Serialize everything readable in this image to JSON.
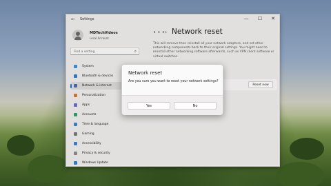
{
  "window": {
    "app_title": "Settings",
    "back_icon": "back-arrow-icon",
    "controls": {
      "minimize": "—",
      "maximize": "☐",
      "close": "✕"
    }
  },
  "user": {
    "name": "MDTechVideos",
    "account_type": "Local Account"
  },
  "search": {
    "placeholder": "Find a setting",
    "icon": "search-icon"
  },
  "sidebar": {
    "items": [
      {
        "label": "System",
        "icon": "monitor-icon",
        "color": "#3b8fd6",
        "active": false
      },
      {
        "label": "Bluetooth & devices",
        "icon": "bluetooth-icon",
        "color": "#2a7fd0",
        "active": false
      },
      {
        "label": "Network & internet",
        "icon": "wifi-icon",
        "color": "#4a6aa8",
        "active": true
      },
      {
        "label": "Personalization",
        "icon": "brush-icon",
        "color": "#d07a2a",
        "active": false
      },
      {
        "label": "Apps",
        "icon": "apps-icon",
        "color": "#6b6bd0",
        "active": false
      },
      {
        "label": "Accounts",
        "icon": "person-icon",
        "color": "#2e9e6c",
        "active": false
      },
      {
        "label": "Time & language",
        "icon": "globe-clock-icon",
        "color": "#3a86c8",
        "active": false
      },
      {
        "label": "Gaming",
        "icon": "gamepad-icon",
        "color": "#777777",
        "active": false
      },
      {
        "label": "Accessibility",
        "icon": "accessibility-icon",
        "color": "#3a7fd0",
        "active": false
      },
      {
        "label": "Privacy & security",
        "icon": "shield-icon",
        "color": "#8a8a8a",
        "active": false
      },
      {
        "label": "Windows Update",
        "icon": "update-icon",
        "color": "#2a7fd0",
        "active": false
      }
    ]
  },
  "content": {
    "breadcrumb_dots": "• • •",
    "breadcrumb_sep": "›",
    "title": "Network reset",
    "description": "This will remove then reinstall all your network adapters, and set other networking components back to their original settings. You might need to reinstall other networking software afterwards, such as VPN client software or virtual switches.",
    "reset_button": "Reset now"
  },
  "dialog": {
    "title": "Network reset",
    "message": "Are you sure you want to reset your network settings?",
    "yes": "Yes",
    "no": "No"
  },
  "accent_color": "#1a6fd4"
}
